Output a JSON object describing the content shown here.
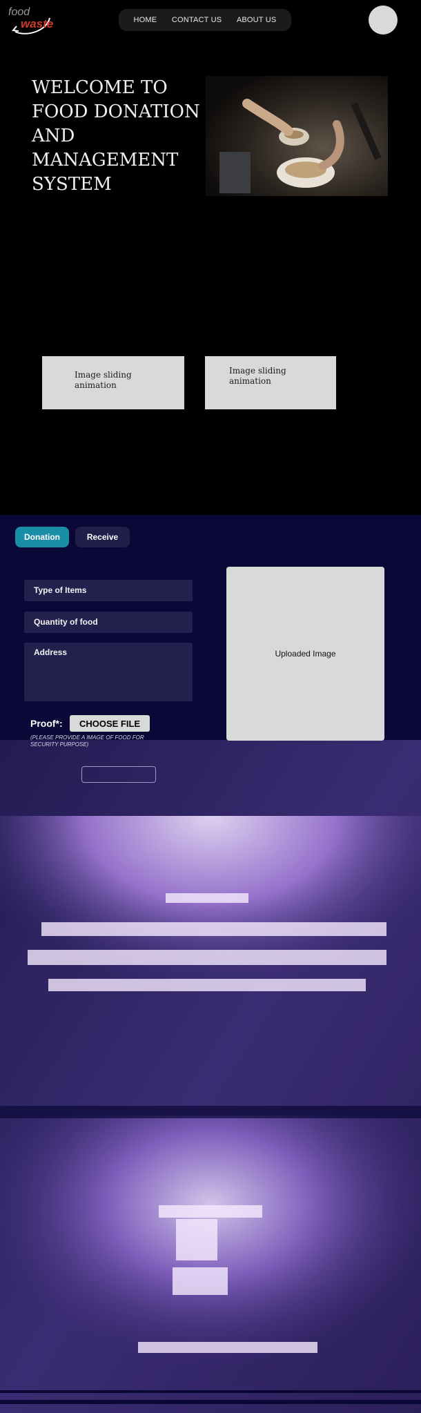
{
  "header": {
    "logo": {
      "top_word": "food",
      "bottom_word": "waste"
    },
    "nav": [
      "HOME",
      "CONTACT US",
      "ABOUT US"
    ]
  },
  "hero": {
    "title": "WELCOME TO\nFOOD DONATION\nAND\nMANAGEMENT\nSYSTEM",
    "slides": [
      "Image sliding\nanimation",
      "Image sliding\nanimation"
    ]
  },
  "form": {
    "tabs": {
      "donation": "Donation",
      "receive": "Receive"
    },
    "fields": {
      "type_of_items": "Type of Items",
      "quantity_of_food": "Quantity of food",
      "address": "Address"
    },
    "uploaded_image": "Uploaded Image",
    "proof_label": "Proof*:",
    "choose_file": "CHOOSE FILE",
    "proof_note": "(PLEASE PROVIDE A IMAGE OF FOOD FOR SECURITY PURPOSE)"
  },
  "colors": {
    "section_bg": "#0a0836",
    "accent": "#1a8ea6",
    "logo_red": "#d33a2c"
  }
}
